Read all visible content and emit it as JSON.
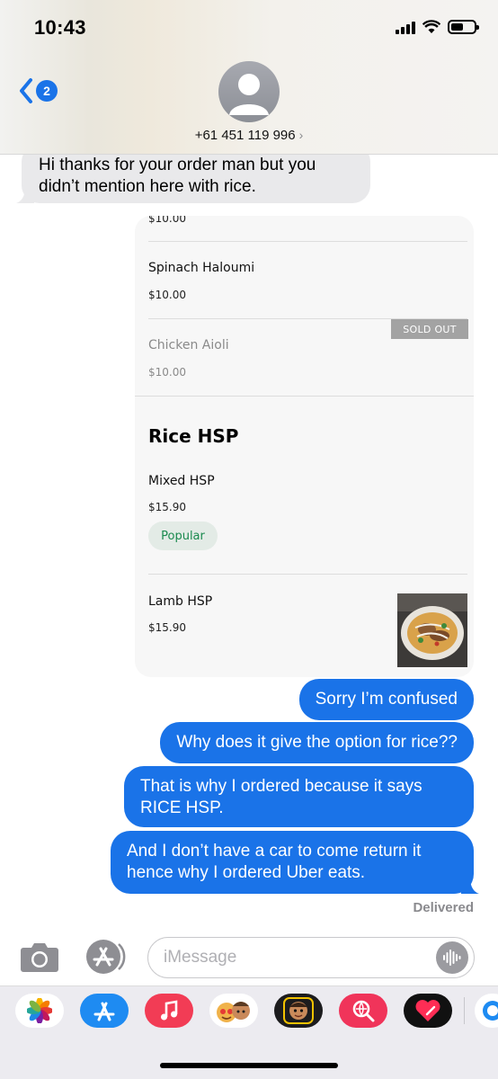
{
  "status_bar": {
    "time": "10:43",
    "icons": [
      "signal-icon",
      "wifi-icon",
      "battery-icon"
    ]
  },
  "nav": {
    "back_badge": "2",
    "contact": "+61 451 119 996",
    "contact_chevron": "›"
  },
  "messages": [
    {
      "direction": "incoming",
      "text": "Hi thanks for your order man but you didn’t mention here with rice."
    },
    {
      "direction": "outgoing",
      "type": "image"
    },
    {
      "direction": "outgoing",
      "text": "Sorry I’m confused"
    },
    {
      "direction": "outgoing",
      "text": "Why does it give the option for rice??"
    },
    {
      "direction": "outgoing",
      "text": "That is why I ordered because it says RICE HSP."
    },
    {
      "direction": "outgoing",
      "text": "And I don’t have a car to come return it hence why I ordered Uber eats."
    }
  ],
  "screenshot_card": {
    "top_price": "$10.00",
    "items": [
      {
        "name": "Spinach Haloumi",
        "price": "$10.00"
      },
      {
        "name": "Chicken Aioli",
        "price": "$10.00",
        "badge": "SOLD OUT"
      },
      {
        "name": "Mixed HSP",
        "price": "$15.90",
        "tag": "Popular"
      },
      {
        "name": "Lamb HSP",
        "price": "$15.90"
      }
    ],
    "section_title": "Rice HSP"
  },
  "delivered_label": "Delivered",
  "input": {
    "placeholder": "iMessage"
  },
  "drawer_apps": [
    "photos-app-icon",
    "app-store-app-icon",
    "music-app-icon",
    "memoji-stickers-icon",
    "animoji-icon",
    "images-search-icon",
    "digital-touch-icon",
    "more-app-icon"
  ],
  "colors": {
    "outgoing_bubble": "#1a73e8",
    "incoming_bubble": "#e9e9eb",
    "popular_text": "#1b8a4f"
  }
}
